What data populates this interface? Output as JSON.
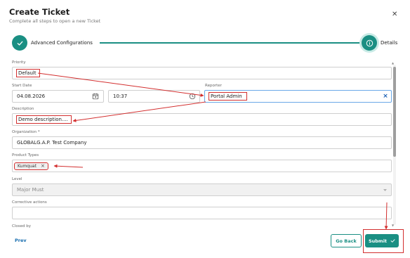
{
  "dialog": {
    "title": "Create Ticket",
    "subtitle": "Complete all steps to open a new Ticket"
  },
  "steps": [
    {
      "label": "Advanced Configurations",
      "icon": "check-icon",
      "state": "completed"
    },
    {
      "label": "Details",
      "icon": "info-icon",
      "state": "active"
    }
  ],
  "form": {
    "priority": {
      "label": "Priority",
      "value": "Default"
    },
    "start_date": {
      "label": "Start Date",
      "date": "04.08.2026",
      "time": "10:37"
    },
    "reporter": {
      "label": "Reporter",
      "value": "Portal Admin"
    },
    "description": {
      "label": "Description",
      "value": "Demo description...."
    },
    "organization": {
      "label": "Organization *",
      "value": "GLOBALG.A.P. Test Company"
    },
    "product_types": {
      "label": "Product Types",
      "chips": [
        "Kumquat"
      ]
    },
    "level": {
      "label": "Level",
      "value": "Major Must"
    },
    "corrective_actions": {
      "label": "Corrective actions",
      "value": ""
    },
    "closed_by": {
      "label": "Closed by"
    }
  },
  "footer": {
    "prev_label": "Prev",
    "go_back_label": "Go Back",
    "submit_label": "Submit"
  },
  "annotation_color": "#d32f2f",
  "accent_color": "#1a8f83"
}
